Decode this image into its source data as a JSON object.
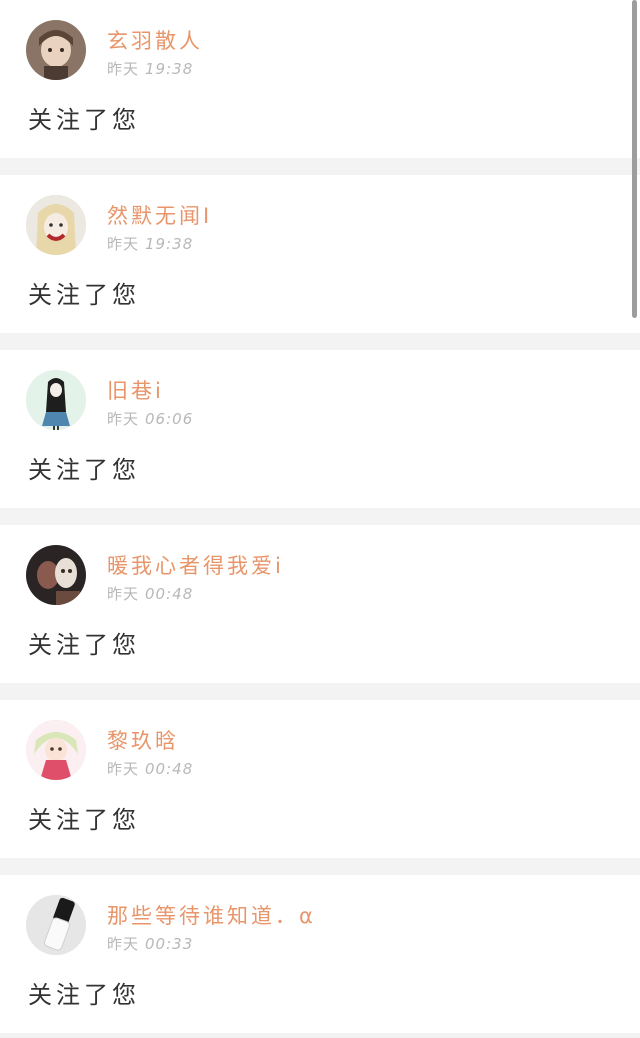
{
  "notifications": [
    {
      "username": "玄羽散人",
      "day": "昨天",
      "time": "19:38",
      "message": "关注了您",
      "avatar_icon": "avatar-icon"
    },
    {
      "username": "然默无闻I",
      "day": "昨天",
      "time": "19:38",
      "message": "关注了您",
      "avatar_icon": "avatar-icon"
    },
    {
      "username": "旧巷i",
      "day": "昨天",
      "time": "06:06",
      "message": "关注了您",
      "avatar_icon": "avatar-icon"
    },
    {
      "username": "暖我心者得我爱i",
      "day": "昨天",
      "time": "00:48",
      "message": "关注了您",
      "avatar_icon": "avatar-icon"
    },
    {
      "username": "黎玖晗",
      "day": "昨天",
      "time": "00:48",
      "message": "关注了您",
      "avatar_icon": "avatar-icon"
    },
    {
      "username": "那些等待谁知道．α",
      "day": "昨天",
      "time": "00:33",
      "message": "关注了您",
      "avatar_icon": "avatar-icon"
    }
  ],
  "colors": {
    "username": "#e8956a",
    "timestamp": "#b8b8b8",
    "message": "#333333",
    "separator": "#f3f3f3"
  }
}
